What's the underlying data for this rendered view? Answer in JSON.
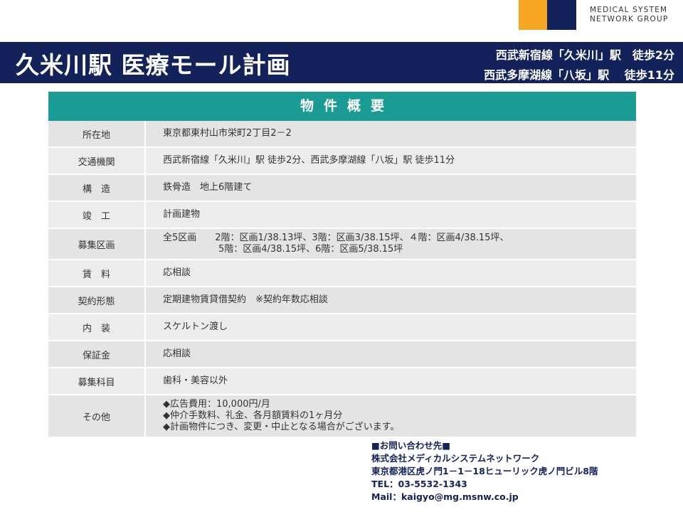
{
  "logo": {
    "line1": "MEDICAL SYSTEM",
    "line2": "NETWORK GROUP",
    "colors": {
      "orange": "#f5a623",
      "navy": "#13225b"
    }
  },
  "header": {
    "title": "久米川駅 医療モール計画",
    "access_line1": "西武新宿線「久米川」駅　徒歩2分",
    "access_line2": "西武多摩湖線「八坂」駅　 徒歩11分"
  },
  "overview": {
    "heading": "物件概要",
    "rows": [
      {
        "label": "所在地",
        "lines": [
          "東京都東村山市栄町2丁目2－2"
        ]
      },
      {
        "label": "交通機関",
        "lines": [
          "西武新宿線「久米川」駅 徒歩2分、西武多摩湖線「八坂」駅 徒歩11分"
        ]
      },
      {
        "label": "構　造",
        "lines": [
          "鉄骨造　地上6階建て"
        ]
      },
      {
        "label": "竣　工",
        "lines": [
          "計画建物"
        ]
      },
      {
        "label": "募集区画",
        "lines": [
          "全5区画　　2階：区画1/38.13坪、3階：区画3/38.15坪、４階：区画4/38.15坪、",
          "　　　　　　5階：区画4/38.15坪、6階：区画5/38.15坪"
        ]
      },
      {
        "label": "賃　料",
        "lines": [
          "応相談"
        ]
      },
      {
        "label": "契約形態",
        "lines": [
          "定期建物賃貸借契約　※契約年数応相談"
        ]
      },
      {
        "label": "内　装",
        "lines": [
          "スケルトン渡し"
        ]
      },
      {
        "label": "保証金",
        "lines": [
          "応相談"
        ]
      },
      {
        "label": "募集科目",
        "lines": [
          "歯科・美容以外"
        ]
      },
      {
        "label": "その他",
        "lines": [
          "◆広告費用：10,000円/月",
          "◆仲介手数料、礼金、各月額賃料の1ヶ月分",
          "◆計画物件につき、変更・中止となる場合がございます。"
        ]
      }
    ]
  },
  "contact": {
    "heading": "■お問い合わせ先■",
    "company": "株式会社メディカルシステムネットワーク",
    "address": "東京都港区虎ノ門1－1－18ヒューリック虎ノ門ビル8階",
    "tel": "TEL：03-5532-1343",
    "mail": "Mail：kaigyo@mg.msnw.co.jp"
  }
}
